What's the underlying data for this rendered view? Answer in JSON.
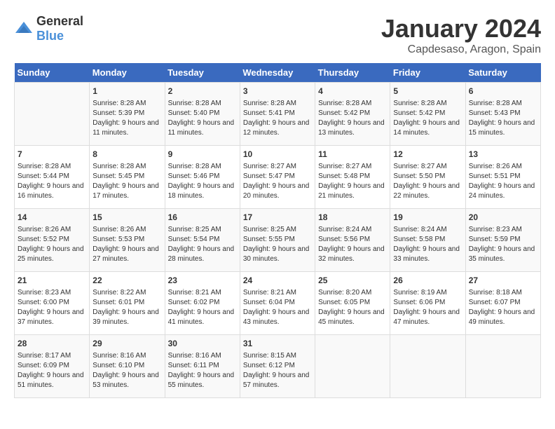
{
  "header": {
    "logo": {
      "general": "General",
      "blue": "Blue"
    },
    "title": "January 2024",
    "location": "Capdesaso, Aragon, Spain"
  },
  "weekdays": [
    "Sunday",
    "Monday",
    "Tuesday",
    "Wednesday",
    "Thursday",
    "Friday",
    "Saturday"
  ],
  "weeks": [
    [
      {
        "day": "",
        "sunrise": "",
        "sunset": "",
        "daylight": ""
      },
      {
        "day": "1",
        "sunrise": "Sunrise: 8:28 AM",
        "sunset": "Sunset: 5:39 PM",
        "daylight": "Daylight: 9 hours and 11 minutes."
      },
      {
        "day": "2",
        "sunrise": "Sunrise: 8:28 AM",
        "sunset": "Sunset: 5:40 PM",
        "daylight": "Daylight: 9 hours and 11 minutes."
      },
      {
        "day": "3",
        "sunrise": "Sunrise: 8:28 AM",
        "sunset": "Sunset: 5:41 PM",
        "daylight": "Daylight: 9 hours and 12 minutes."
      },
      {
        "day": "4",
        "sunrise": "Sunrise: 8:28 AM",
        "sunset": "Sunset: 5:42 PM",
        "daylight": "Daylight: 9 hours and 13 minutes."
      },
      {
        "day": "5",
        "sunrise": "Sunrise: 8:28 AM",
        "sunset": "Sunset: 5:42 PM",
        "daylight": "Daylight: 9 hours and 14 minutes."
      },
      {
        "day": "6",
        "sunrise": "Sunrise: 8:28 AM",
        "sunset": "Sunset: 5:43 PM",
        "daylight": "Daylight: 9 hours and 15 minutes."
      }
    ],
    [
      {
        "day": "7",
        "sunrise": "Sunrise: 8:28 AM",
        "sunset": "Sunset: 5:44 PM",
        "daylight": "Daylight: 9 hours and 16 minutes."
      },
      {
        "day": "8",
        "sunrise": "Sunrise: 8:28 AM",
        "sunset": "Sunset: 5:45 PM",
        "daylight": "Daylight: 9 hours and 17 minutes."
      },
      {
        "day": "9",
        "sunrise": "Sunrise: 8:28 AM",
        "sunset": "Sunset: 5:46 PM",
        "daylight": "Daylight: 9 hours and 18 minutes."
      },
      {
        "day": "10",
        "sunrise": "Sunrise: 8:27 AM",
        "sunset": "Sunset: 5:47 PM",
        "daylight": "Daylight: 9 hours and 20 minutes."
      },
      {
        "day": "11",
        "sunrise": "Sunrise: 8:27 AM",
        "sunset": "Sunset: 5:48 PM",
        "daylight": "Daylight: 9 hours and 21 minutes."
      },
      {
        "day": "12",
        "sunrise": "Sunrise: 8:27 AM",
        "sunset": "Sunset: 5:50 PM",
        "daylight": "Daylight: 9 hours and 22 minutes."
      },
      {
        "day": "13",
        "sunrise": "Sunrise: 8:26 AM",
        "sunset": "Sunset: 5:51 PM",
        "daylight": "Daylight: 9 hours and 24 minutes."
      }
    ],
    [
      {
        "day": "14",
        "sunrise": "Sunrise: 8:26 AM",
        "sunset": "Sunset: 5:52 PM",
        "daylight": "Daylight: 9 hours and 25 minutes."
      },
      {
        "day": "15",
        "sunrise": "Sunrise: 8:26 AM",
        "sunset": "Sunset: 5:53 PM",
        "daylight": "Daylight: 9 hours and 27 minutes."
      },
      {
        "day": "16",
        "sunrise": "Sunrise: 8:25 AM",
        "sunset": "Sunset: 5:54 PM",
        "daylight": "Daylight: 9 hours and 28 minutes."
      },
      {
        "day": "17",
        "sunrise": "Sunrise: 8:25 AM",
        "sunset": "Sunset: 5:55 PM",
        "daylight": "Daylight: 9 hours and 30 minutes."
      },
      {
        "day": "18",
        "sunrise": "Sunrise: 8:24 AM",
        "sunset": "Sunset: 5:56 PM",
        "daylight": "Daylight: 9 hours and 32 minutes."
      },
      {
        "day": "19",
        "sunrise": "Sunrise: 8:24 AM",
        "sunset": "Sunset: 5:58 PM",
        "daylight": "Daylight: 9 hours and 33 minutes."
      },
      {
        "day": "20",
        "sunrise": "Sunrise: 8:23 AM",
        "sunset": "Sunset: 5:59 PM",
        "daylight": "Daylight: 9 hours and 35 minutes."
      }
    ],
    [
      {
        "day": "21",
        "sunrise": "Sunrise: 8:23 AM",
        "sunset": "Sunset: 6:00 PM",
        "daylight": "Daylight: 9 hours and 37 minutes."
      },
      {
        "day": "22",
        "sunrise": "Sunrise: 8:22 AM",
        "sunset": "Sunset: 6:01 PM",
        "daylight": "Daylight: 9 hours and 39 minutes."
      },
      {
        "day": "23",
        "sunrise": "Sunrise: 8:21 AM",
        "sunset": "Sunset: 6:02 PM",
        "daylight": "Daylight: 9 hours and 41 minutes."
      },
      {
        "day": "24",
        "sunrise": "Sunrise: 8:21 AM",
        "sunset": "Sunset: 6:04 PM",
        "daylight": "Daylight: 9 hours and 43 minutes."
      },
      {
        "day": "25",
        "sunrise": "Sunrise: 8:20 AM",
        "sunset": "Sunset: 6:05 PM",
        "daylight": "Daylight: 9 hours and 45 minutes."
      },
      {
        "day": "26",
        "sunrise": "Sunrise: 8:19 AM",
        "sunset": "Sunset: 6:06 PM",
        "daylight": "Daylight: 9 hours and 47 minutes."
      },
      {
        "day": "27",
        "sunrise": "Sunrise: 8:18 AM",
        "sunset": "Sunset: 6:07 PM",
        "daylight": "Daylight: 9 hours and 49 minutes."
      }
    ],
    [
      {
        "day": "28",
        "sunrise": "Sunrise: 8:17 AM",
        "sunset": "Sunset: 6:09 PM",
        "daylight": "Daylight: 9 hours and 51 minutes."
      },
      {
        "day": "29",
        "sunrise": "Sunrise: 8:16 AM",
        "sunset": "Sunset: 6:10 PM",
        "daylight": "Daylight: 9 hours and 53 minutes."
      },
      {
        "day": "30",
        "sunrise": "Sunrise: 8:16 AM",
        "sunset": "Sunset: 6:11 PM",
        "daylight": "Daylight: 9 hours and 55 minutes."
      },
      {
        "day": "31",
        "sunrise": "Sunrise: 8:15 AM",
        "sunset": "Sunset: 6:12 PM",
        "daylight": "Daylight: 9 hours and 57 minutes."
      },
      {
        "day": "",
        "sunrise": "",
        "sunset": "",
        "daylight": ""
      },
      {
        "day": "",
        "sunrise": "",
        "sunset": "",
        "daylight": ""
      },
      {
        "day": "",
        "sunrise": "",
        "sunset": "",
        "daylight": ""
      }
    ]
  ]
}
